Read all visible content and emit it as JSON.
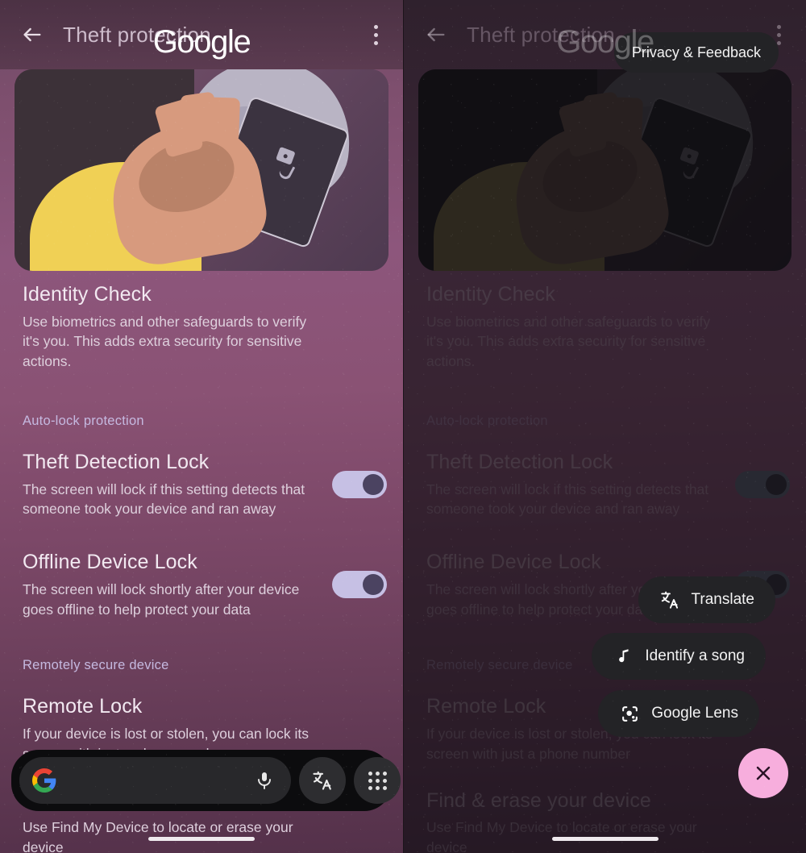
{
  "appbar": {
    "title": "Theft protection",
    "back_icon": "back-arrow-icon",
    "overflow_icon": "overflow-menu-icon",
    "google_wordmark": "Google"
  },
  "hero": {
    "alt": "theft-protection-illustration"
  },
  "settings": [
    {
      "id": "identity-check",
      "title": "Identity Check",
      "desc": "Use biometrics and other safeguards to verify it's you. This adds extra security for sensitive actions.",
      "toggle": null
    },
    {
      "id": "theft-detection-lock",
      "title": "Theft Detection Lock",
      "desc": "The screen will lock if this setting detects that someone took your device and ran away",
      "toggle": "on"
    },
    {
      "id": "offline-device-lock",
      "title": "Offline Device Lock",
      "desc": "The screen will lock shortly after your device goes offline to help protect your data",
      "toggle": "on"
    },
    {
      "id": "remote-lock",
      "title": "Remote Lock",
      "desc": "If your device is lost or stolen, you can lock its screen with just a phone number",
      "toggle": null
    },
    {
      "id": "find-erase-device",
      "title": "Find & erase your device",
      "desc": "Use Find My Device to locate or erase your device",
      "toggle": null
    }
  ],
  "sections": {
    "auto_lock": "Auto-lock protection",
    "remote_secure": "Remotely secure device"
  },
  "searchbar": {
    "google_logo": "google-g-logo",
    "input_value": "",
    "input_placeholder": "",
    "mic_icon": "microphone-icon",
    "translate_icon": "translate-icon",
    "apps_icon": "apps-grid-icon"
  },
  "assistant_menu": {
    "privacy_feedback": "Privacy & Feedback",
    "items": [
      {
        "label": "Translate",
        "icon": "translate-icon"
      },
      {
        "label": "Identify a song",
        "icon": "music-note-icon"
      },
      {
        "label": "Google Lens",
        "icon": "google-lens-icon"
      }
    ],
    "close_icon": "close-icon"
  },
  "colors": {
    "background_top": "#8d567c",
    "background_bottom": "#54314a",
    "toggle_track_on": "#c6c0e4",
    "toggle_knob_on": "#4b4361",
    "section_label": "#c5b9e0",
    "fab_close": "#f7aedd",
    "pill_background": "#232326",
    "searchbar_background": "#0c0c0e"
  }
}
